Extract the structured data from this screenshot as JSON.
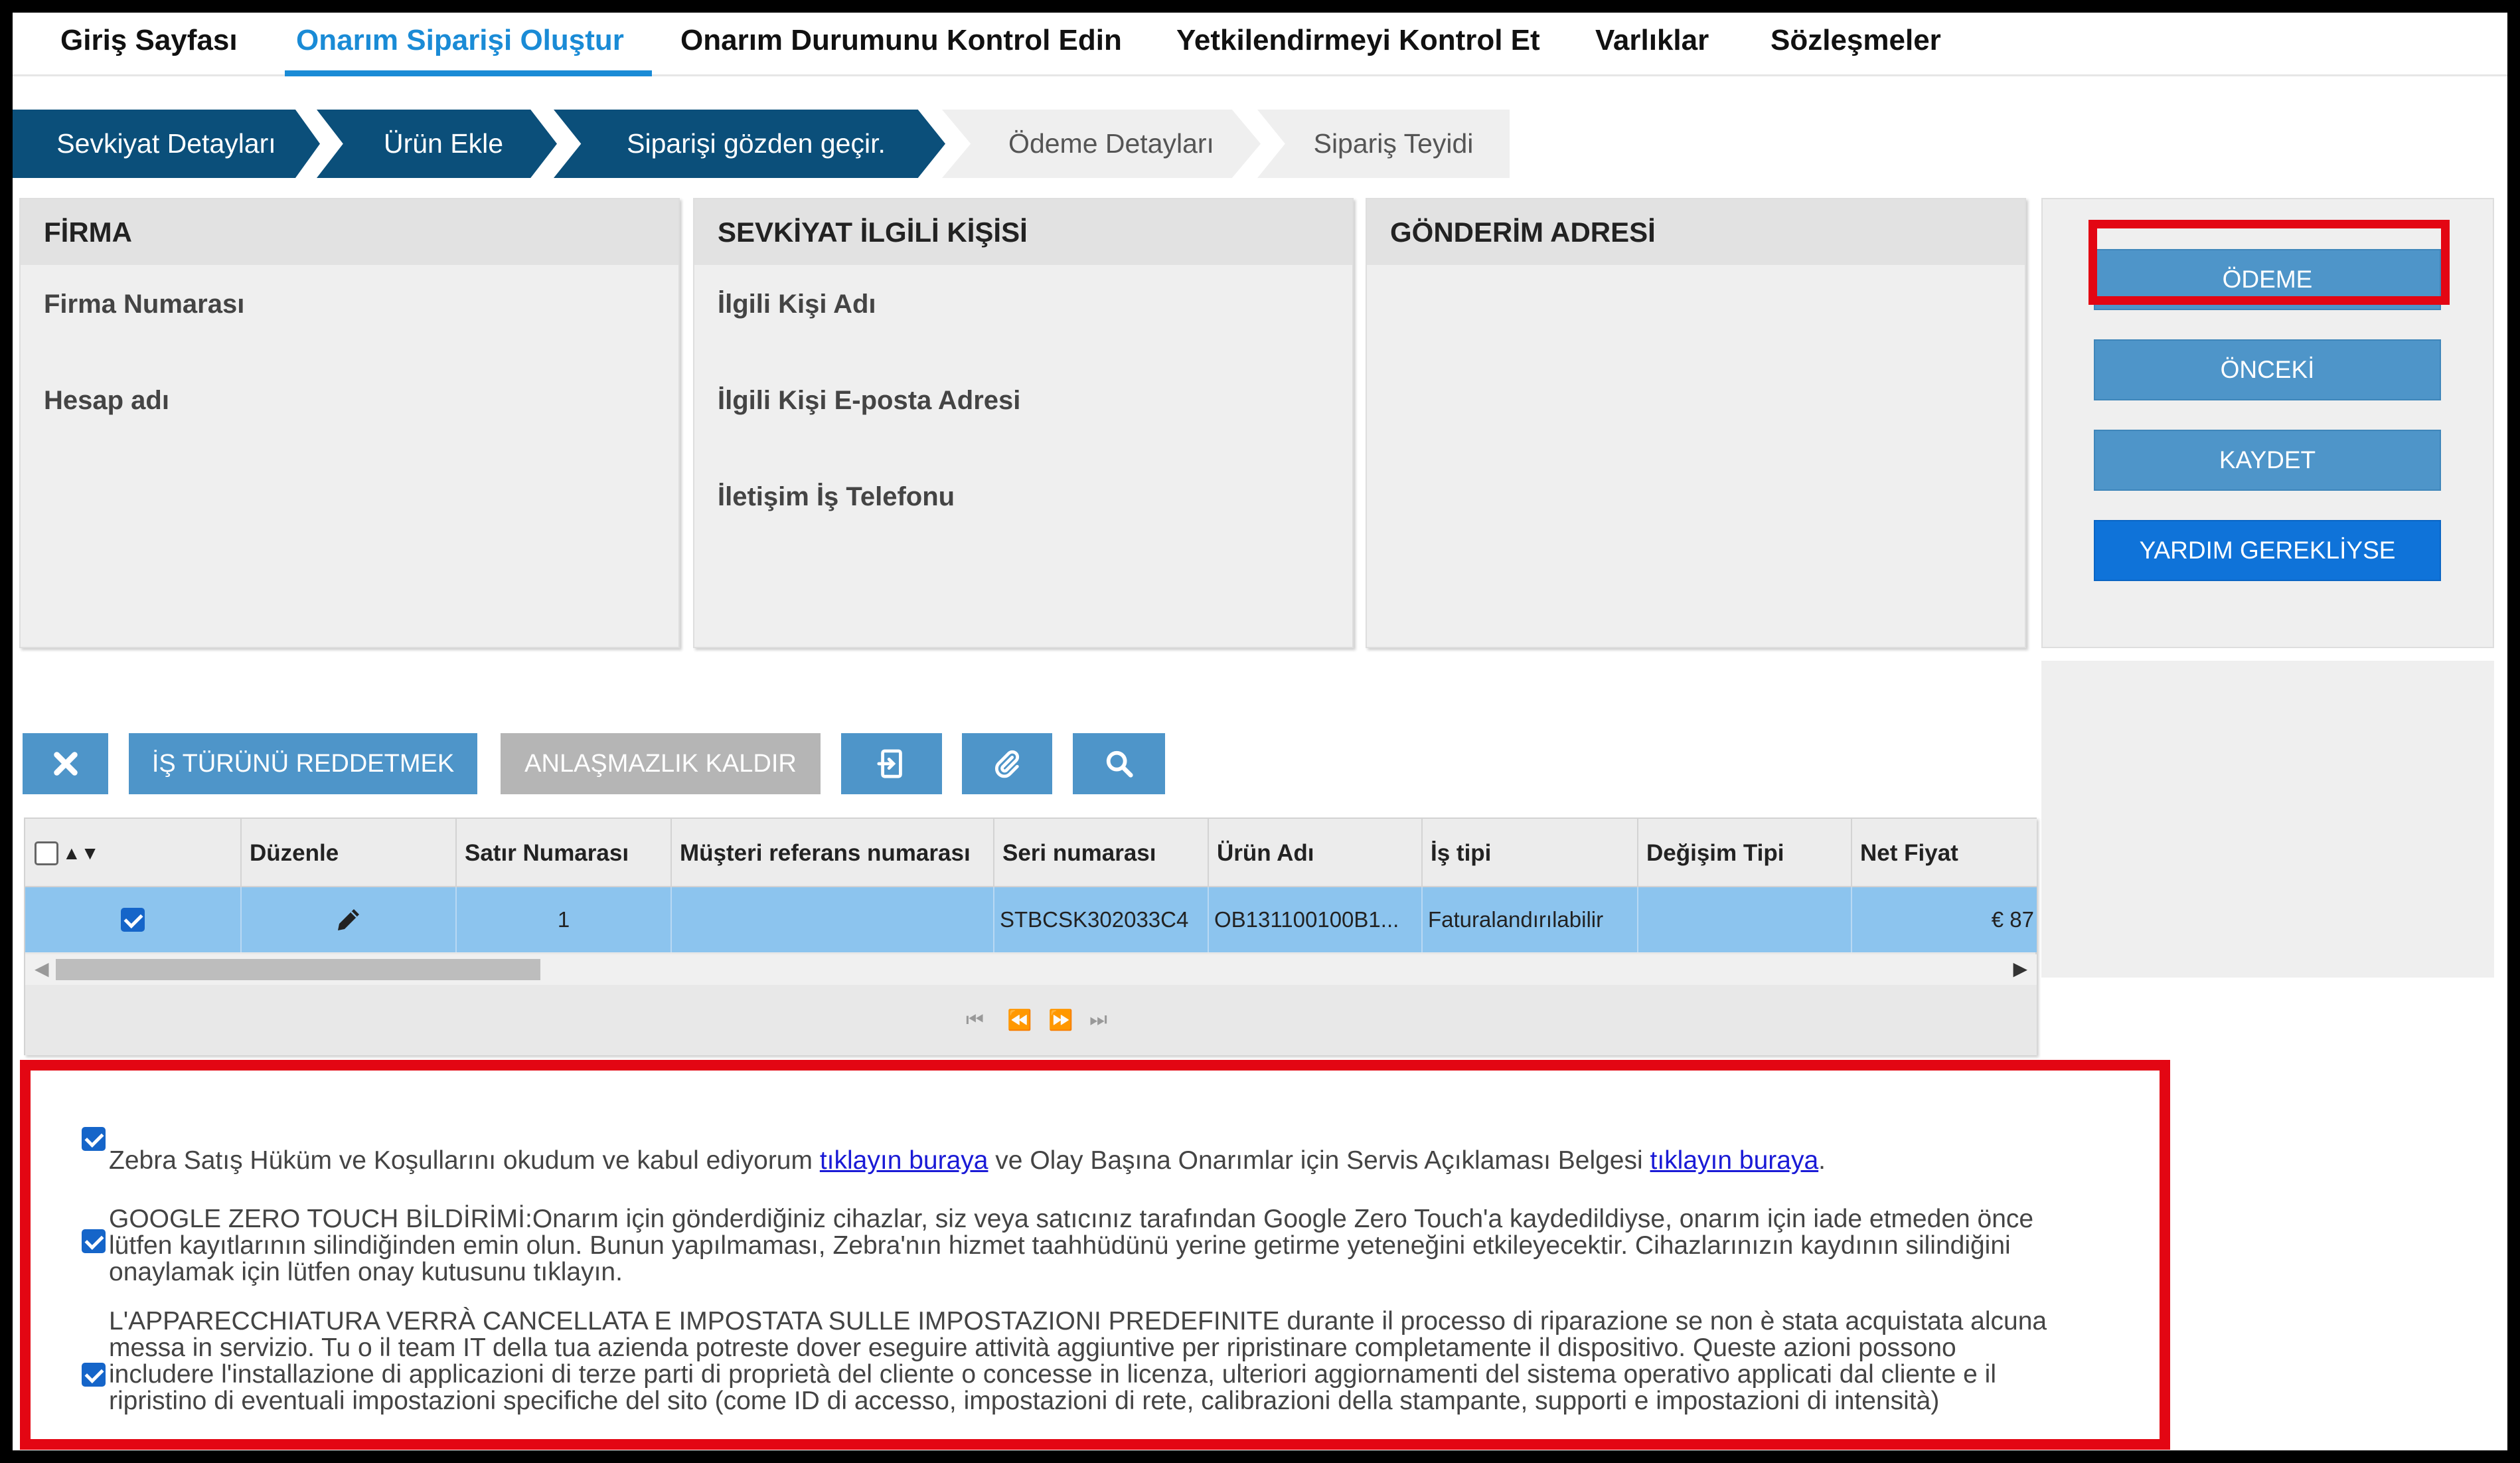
{
  "nav": {
    "items": [
      "Giriş Sayfası",
      "Onarım Siparişi Oluştur",
      "Onarım Durumunu Kontrol Edin",
      "Yetkilendirmeyi Kontrol Et",
      "Varlıklar",
      "Sözleşmeler"
    ],
    "active": "Onarım Siparişi Oluştur"
  },
  "steps": [
    "Sevkiyat Detayları",
    "Ürün Ekle",
    "Siparişi gözden geçir.",
    "Ödeme Detayları",
    "Sipariş Teyidi"
  ],
  "panels": {
    "firma": {
      "title": "FİRMA",
      "fields": [
        "Firma Numarası",
        "Hesap adı"
      ]
    },
    "contact": {
      "title": "SEVKİYAT İLGİLİ KİŞİSİ",
      "fields": [
        "İlgili Kişi Adı",
        "İlgili Kişi E-posta Adresi",
        "İletişim İş Telefonu"
      ]
    },
    "address": {
      "title": "GÖNDERİM ADRESİ"
    }
  },
  "side_buttons": {
    "odeme": "ÖDEME",
    "onceki": "ÖNCEKİ",
    "kaydet": "KAYDET",
    "help": "YARDIM GEREKLİYSE"
  },
  "toolbar": {
    "reject": "İŞ TÜRÜNÜ REDDETMEK",
    "dispute": "ANLAŞMAZLIK KALDIR"
  },
  "grid": {
    "headers": [
      "Düzenle",
      "Satır Numarası",
      "Müşteri referans numarası",
      "Seri numarası",
      "Ürün Adı",
      "İş tipi",
      "Değişim Tipi",
      "Net Fiyat"
    ],
    "row": {
      "line": "1",
      "customer_ref": "",
      "serial": "STBCSK302033C4",
      "product": "OB131100100B1...",
      "job_type": "Faturalandırılabilir",
      "exchange": "",
      "price": "€ 87"
    }
  },
  "terms": {
    "t1_a": "Zebra Satış Hüküm ve Koşullarını okudum ve kabul ediyorum ",
    "t1_link1": "tıklayın buraya",
    "t1_b": " ve Olay Başına Onarımlar için Servis Açıklaması Belgesi ",
    "t1_link2": "tıklayın buraya",
    "t1_c": ".",
    "t2": "GOOGLE ZERO TOUCH BİLDİRİMİ:Onarım için gönderdiğiniz cihazlar, siz veya satıcınız tarafından Google Zero Touch'a kaydedildiyse, onarım için iade etmeden önce lütfen kayıtlarının silindiğinden emin olun. Bunun yapılmaması, Zebra'nın hizmet taahhüdünü yerine getirme yeteneğini etkileyecektir. Cihazlarınızın kaydının silindiğini onaylamak için lütfen onay kutusunu tıklayın.",
    "t3": "L'APPARECCHIATURA VERRÀ CANCELLATA E IMPOSTATA SULLE IMPOSTAZIONI PREDEFINITE durante il processo di riparazione se non è stata acquistata alcuna messa in servizio. Tu o il team IT della tua azienda potreste dover eseguire attività aggiuntive per ripristinare completamente il dispositivo. Queste azioni possono includere l'installazione di applicazioni di terze parti di proprietà del cliente o concesse in licenza, ulteriori aggiornamenti del sistema operativo applicati dal cliente e il ripristino di eventuali impostazioni specifiche del sito (come ID di accesso, impostazioni di rete, calibrazioni della stampante, supporti e impostazioni di intensità)"
  },
  "colors": {
    "accent": "#1a8bd6",
    "step_done": "#0b4f7a",
    "button": "#4e95c9",
    "help_button": "#0f73d9",
    "row_selected": "#8cc4ee",
    "highlight": "#e30613"
  }
}
